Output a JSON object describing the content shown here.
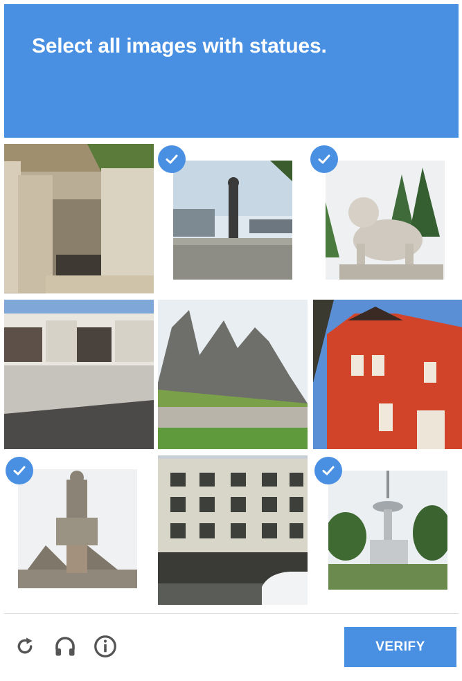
{
  "header": {
    "prompt_prefix": "Select all images with ",
    "prompt_object": "statues",
    "prompt_suffix": "."
  },
  "tiles": [
    {
      "subject": "concrete walls",
      "selected": false
    },
    {
      "subject": "statue on pedestal",
      "selected": true
    },
    {
      "subject": "stone lion statue",
      "selected": true
    },
    {
      "subject": "warehouse garages",
      "selected": false
    },
    {
      "subject": "rock formations",
      "selected": false
    },
    {
      "subject": "red brick building",
      "selected": false
    },
    {
      "subject": "monument sculpture",
      "selected": true
    },
    {
      "subject": "apartment building",
      "selected": false
    },
    {
      "subject": "tower",
      "selected": true
    }
  ],
  "footer": {
    "reload_icon": "reload-icon",
    "audio_icon": "headphones-icon",
    "info_icon": "info-icon",
    "verify_label": "VERIFY"
  },
  "colors": {
    "accent": "#4a90e2",
    "icon_gray": "#555555"
  }
}
